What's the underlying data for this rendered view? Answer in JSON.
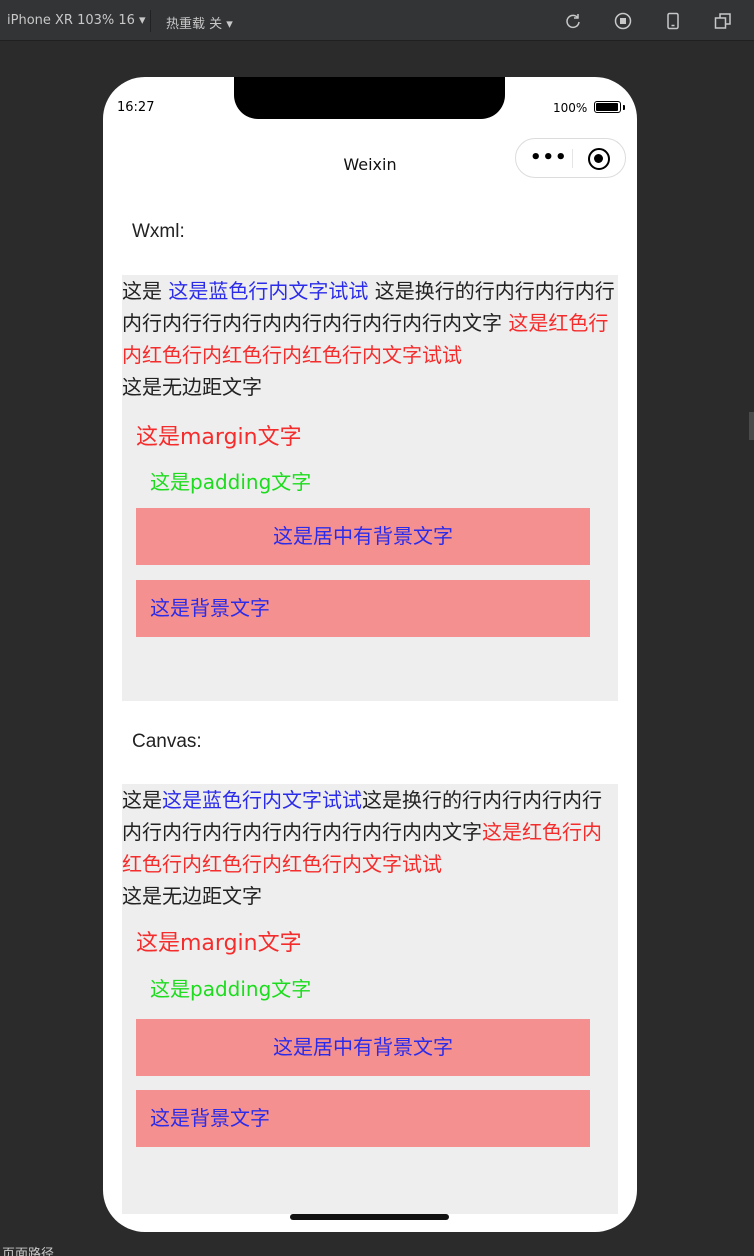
{
  "devtools": {
    "device_label": "iPhone XR 103% 16 ▾",
    "hot_reload_label": "热重载 关 ▾",
    "icons": [
      "refresh-icon",
      "record-icon",
      "phone-icon",
      "window-icon"
    ],
    "bottom_path_label": "页面路径"
  },
  "status": {
    "time": "16:27",
    "battery": "100%",
    "battery_level": 1.0
  },
  "nav": {
    "title": "Weixin",
    "more_glyph": "•••"
  },
  "wxml": {
    "title": "Wxml:",
    "text_prefix": "这是 ",
    "blue_text": "这是蓝色行内文字试试",
    "wrap_text": " 这是换行的行内行内行内行内行内行行内行内内行内行内行内行内文字 ",
    "red_text": "这是红色行内红色行内红色行内红色行内文字试试",
    "no_margin_text": "这是无边距文字",
    "margin_text": "这是margin文字",
    "padding_text": "这是padding文字",
    "center_bg_text": "这是居中有背景文字",
    "bg_text": "这是背景文字"
  },
  "canvas": {
    "title": "Canvas:",
    "text_prefix": "这是",
    "blue_text": "这是蓝色行内文字试试",
    "wrap_text": "这是换行的行内行内行内行内行内行内行内行内行内行内行内内文字",
    "red_text": "这是红色行内红色行内红色行内红色行内文字试试",
    "no_margin_text": "这是无边距文字",
    "margin_text": "这是margin文字",
    "padding_text": "这是padding文字",
    "center_bg_text": "这是居中有背景文字",
    "bg_text": "这是背景文字"
  },
  "colors": {
    "blue": "#2b2bea",
    "red": "#f52c2c",
    "green": "#1ddc1d",
    "bg_box": "#f59090",
    "block_bg": "#eeeeee"
  }
}
